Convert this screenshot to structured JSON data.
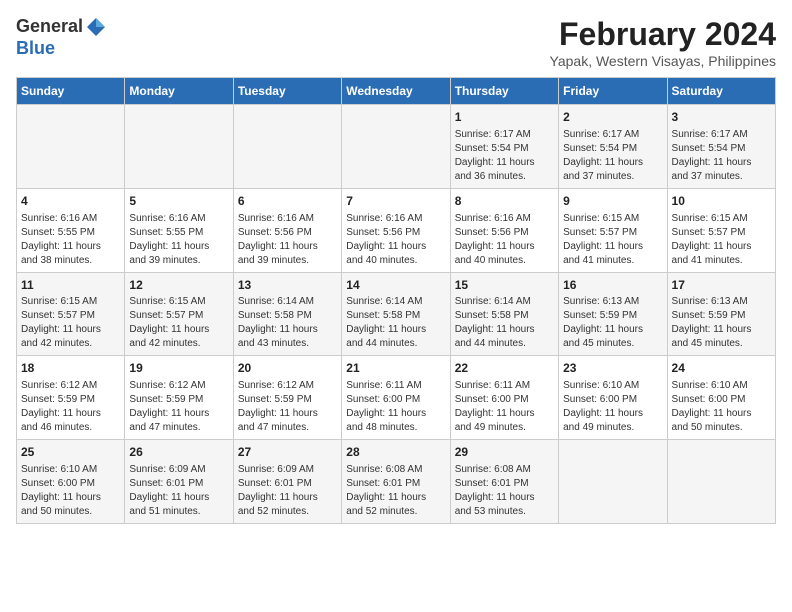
{
  "header": {
    "logo_line1": "General",
    "logo_line2": "Blue",
    "month": "February 2024",
    "location": "Yapak, Western Visayas, Philippines"
  },
  "days_of_week": [
    "Sunday",
    "Monday",
    "Tuesday",
    "Wednesday",
    "Thursday",
    "Friday",
    "Saturday"
  ],
  "weeks": [
    [
      {
        "day": "",
        "info": ""
      },
      {
        "day": "",
        "info": ""
      },
      {
        "day": "",
        "info": ""
      },
      {
        "day": "",
        "info": ""
      },
      {
        "day": "1",
        "info": "Sunrise: 6:17 AM\nSunset: 5:54 PM\nDaylight: 11 hours\nand 36 minutes."
      },
      {
        "day": "2",
        "info": "Sunrise: 6:17 AM\nSunset: 5:54 PM\nDaylight: 11 hours\nand 37 minutes."
      },
      {
        "day": "3",
        "info": "Sunrise: 6:17 AM\nSunset: 5:54 PM\nDaylight: 11 hours\nand 37 minutes."
      }
    ],
    [
      {
        "day": "4",
        "info": "Sunrise: 6:16 AM\nSunset: 5:55 PM\nDaylight: 11 hours\nand 38 minutes."
      },
      {
        "day": "5",
        "info": "Sunrise: 6:16 AM\nSunset: 5:55 PM\nDaylight: 11 hours\nand 39 minutes."
      },
      {
        "day": "6",
        "info": "Sunrise: 6:16 AM\nSunset: 5:56 PM\nDaylight: 11 hours\nand 39 minutes."
      },
      {
        "day": "7",
        "info": "Sunrise: 6:16 AM\nSunset: 5:56 PM\nDaylight: 11 hours\nand 40 minutes."
      },
      {
        "day": "8",
        "info": "Sunrise: 6:16 AM\nSunset: 5:56 PM\nDaylight: 11 hours\nand 40 minutes."
      },
      {
        "day": "9",
        "info": "Sunrise: 6:15 AM\nSunset: 5:57 PM\nDaylight: 11 hours\nand 41 minutes."
      },
      {
        "day": "10",
        "info": "Sunrise: 6:15 AM\nSunset: 5:57 PM\nDaylight: 11 hours\nand 41 minutes."
      }
    ],
    [
      {
        "day": "11",
        "info": "Sunrise: 6:15 AM\nSunset: 5:57 PM\nDaylight: 11 hours\nand 42 minutes."
      },
      {
        "day": "12",
        "info": "Sunrise: 6:15 AM\nSunset: 5:57 PM\nDaylight: 11 hours\nand 42 minutes."
      },
      {
        "day": "13",
        "info": "Sunrise: 6:14 AM\nSunset: 5:58 PM\nDaylight: 11 hours\nand 43 minutes."
      },
      {
        "day": "14",
        "info": "Sunrise: 6:14 AM\nSunset: 5:58 PM\nDaylight: 11 hours\nand 44 minutes."
      },
      {
        "day": "15",
        "info": "Sunrise: 6:14 AM\nSunset: 5:58 PM\nDaylight: 11 hours\nand 44 minutes."
      },
      {
        "day": "16",
        "info": "Sunrise: 6:13 AM\nSunset: 5:59 PM\nDaylight: 11 hours\nand 45 minutes."
      },
      {
        "day": "17",
        "info": "Sunrise: 6:13 AM\nSunset: 5:59 PM\nDaylight: 11 hours\nand 45 minutes."
      }
    ],
    [
      {
        "day": "18",
        "info": "Sunrise: 6:12 AM\nSunset: 5:59 PM\nDaylight: 11 hours\nand 46 minutes."
      },
      {
        "day": "19",
        "info": "Sunrise: 6:12 AM\nSunset: 5:59 PM\nDaylight: 11 hours\nand 47 minutes."
      },
      {
        "day": "20",
        "info": "Sunrise: 6:12 AM\nSunset: 5:59 PM\nDaylight: 11 hours\nand 47 minutes."
      },
      {
        "day": "21",
        "info": "Sunrise: 6:11 AM\nSunset: 6:00 PM\nDaylight: 11 hours\nand 48 minutes."
      },
      {
        "day": "22",
        "info": "Sunrise: 6:11 AM\nSunset: 6:00 PM\nDaylight: 11 hours\nand 49 minutes."
      },
      {
        "day": "23",
        "info": "Sunrise: 6:10 AM\nSunset: 6:00 PM\nDaylight: 11 hours\nand 49 minutes."
      },
      {
        "day": "24",
        "info": "Sunrise: 6:10 AM\nSunset: 6:00 PM\nDaylight: 11 hours\nand 50 minutes."
      }
    ],
    [
      {
        "day": "25",
        "info": "Sunrise: 6:10 AM\nSunset: 6:00 PM\nDaylight: 11 hours\nand 50 minutes."
      },
      {
        "day": "26",
        "info": "Sunrise: 6:09 AM\nSunset: 6:01 PM\nDaylight: 11 hours\nand 51 minutes."
      },
      {
        "day": "27",
        "info": "Sunrise: 6:09 AM\nSunset: 6:01 PM\nDaylight: 11 hours\nand 52 minutes."
      },
      {
        "day": "28",
        "info": "Sunrise: 6:08 AM\nSunset: 6:01 PM\nDaylight: 11 hours\nand 52 minutes."
      },
      {
        "day": "29",
        "info": "Sunrise: 6:08 AM\nSunset: 6:01 PM\nDaylight: 11 hours\nand 53 minutes."
      },
      {
        "day": "",
        "info": ""
      },
      {
        "day": "",
        "info": ""
      }
    ]
  ]
}
